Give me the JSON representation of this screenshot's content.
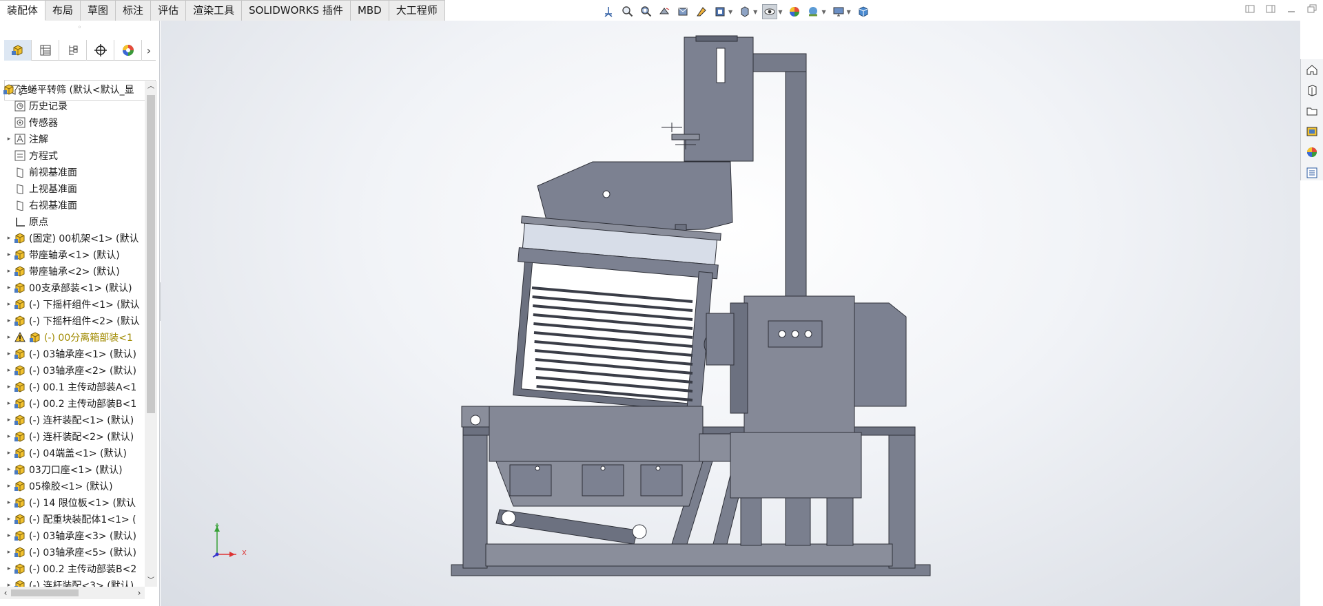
{
  "command_tabs": [
    {
      "label": "装配体",
      "active": true
    },
    {
      "label": "布局"
    },
    {
      "label": "草图"
    },
    {
      "label": "标注"
    },
    {
      "label": "评估"
    },
    {
      "label": "渲染工具"
    },
    {
      "label": "SOLIDWORKS 插件"
    },
    {
      "label": "MBD"
    },
    {
      "label": "大工程师"
    }
  ],
  "hud_icons": [
    "view-orientation-icon",
    "zoom-to-fit-icon",
    "zoom-to-area-icon",
    "previous-view-icon",
    "section-view-icon",
    "dynamic-annotation-icon",
    "view-settings-icon",
    "display-style-icon",
    "hide-show-icon",
    "edit-appearance-icon",
    "apply-scene-icon",
    "view-settings-monitor-icon",
    "cube-icon"
  ],
  "window_controls": [
    "restore-left-icon",
    "restore-right-icon",
    "minimize-icon",
    "maximize-icon"
  ],
  "manager_tabs": [
    "featuremanager-icon",
    "propertymanager-icon",
    "configurationmanager-icon",
    "dimxpert-icon",
    "display-manager-icon"
  ],
  "tree": {
    "root": "选蜷平转筛 (默认<默认_显",
    "items": [
      {
        "label": "历史记录",
        "icon": "history-icon",
        "expandable": false
      },
      {
        "label": "传感器",
        "icon": "sensor-icon",
        "expandable": false
      },
      {
        "label": "注解",
        "icon": "annotation-icon",
        "expandable": true
      },
      {
        "label": "方程式",
        "icon": "equation-icon",
        "expandable": false
      },
      {
        "label": "前视基准面",
        "icon": "plane-icon",
        "expandable": false
      },
      {
        "label": "上视基准面",
        "icon": "plane-icon",
        "expandable": false
      },
      {
        "label": "右视基准面",
        "icon": "plane-icon",
        "expandable": false
      },
      {
        "label": "原点",
        "icon": "origin-icon",
        "expandable": false
      },
      {
        "label": "(固定) 00机架<1> (默认",
        "icon": "assembly-icon",
        "expandable": true
      },
      {
        "label": "带座轴承<1> (默认)",
        "icon": "assembly-icon",
        "expandable": true
      },
      {
        "label": "带座轴承<2> (默认)",
        "icon": "assembly-icon",
        "expandable": true
      },
      {
        "label": "00支承部装<1> (默认)",
        "icon": "assembly-icon",
        "expandable": true
      },
      {
        "label": "(-) 下摇杆组件<1> (默认",
        "icon": "assembly-icon",
        "expandable": true
      },
      {
        "label": "(-) 下摇杆组件<2> (默认",
        "icon": "assembly-icon",
        "expandable": true
      },
      {
        "label": "(-) 00分离箱部装<1",
        "icon": "assembly-icon",
        "expandable": true,
        "warning": true
      },
      {
        "label": "(-) 03轴承座<1> (默认)",
        "icon": "assembly-icon",
        "expandable": true
      },
      {
        "label": "(-) 03轴承座<2> (默认)",
        "icon": "assembly-icon",
        "expandable": true
      },
      {
        "label": "(-) 00.1 主传动部装A<1",
        "icon": "assembly-icon",
        "expandable": true
      },
      {
        "label": "(-) 00.2 主传动部装B<1",
        "icon": "assembly-icon",
        "expandable": true
      },
      {
        "label": "(-) 连杆装配<1> (默认)",
        "icon": "assembly-icon",
        "expandable": true
      },
      {
        "label": "(-) 连杆装配<2> (默认)",
        "icon": "assembly-icon",
        "expandable": true
      },
      {
        "label": "(-) 04端盖<1> (默认)",
        "icon": "assembly-icon",
        "expandable": true
      },
      {
        "label": "03刀口座<1> (默认)",
        "icon": "assembly-icon",
        "expandable": true
      },
      {
        "label": "05橡胶<1> (默认)",
        "icon": "assembly-icon",
        "expandable": true
      },
      {
        "label": "(-) 14 限位板<1> (默认",
        "icon": "assembly-icon",
        "expandable": true
      },
      {
        "label": "(-) 配重块装配体1<1> (",
        "icon": "assembly-icon",
        "expandable": true
      },
      {
        "label": "(-) 03轴承座<3> (默认)",
        "icon": "assembly-icon",
        "expandable": true
      },
      {
        "label": "(-) 03轴承座<5> (默认)",
        "icon": "assembly-icon",
        "expandable": true
      },
      {
        "label": "(-) 00.2 主传动部装B<2",
        "icon": "assembly-icon",
        "expandable": true
      },
      {
        "label": "(-) 连杆装配<3> (默认)",
        "icon": "assembly-icon",
        "expandable": true
      }
    ]
  },
  "triad": {
    "x": "X",
    "y": "Y"
  },
  "task_pane": [
    "home-icon",
    "design-library-icon",
    "file-explorer-icon",
    "view-palette-icon",
    "appearances-icon",
    "custom-properties-icon"
  ],
  "colors": {
    "model_fill": "#7c8191",
    "model_dark": "#5f6473",
    "model_line": "#2e3038",
    "accent": "#dde7f3"
  }
}
